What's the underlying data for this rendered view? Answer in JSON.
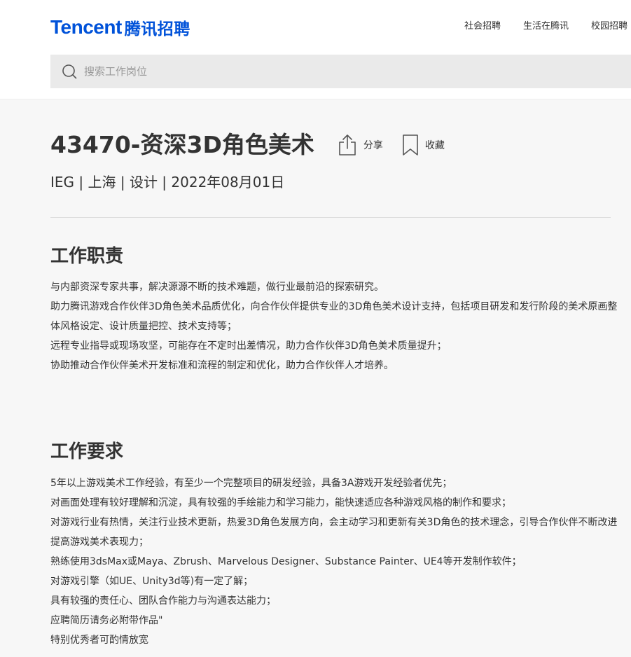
{
  "header": {
    "logo_en": "Tencent",
    "logo_cn": "腾讯招聘",
    "nav": [
      "社会招聘",
      "生活在腾讯",
      "校园招聘"
    ],
    "search_placeholder": "搜索工作岗位",
    "brand_color": "#0052d9"
  },
  "job": {
    "title": "43470-资深3D角色美术",
    "share_label": "分享",
    "favorite_label": "收藏",
    "meta": "IEG | 上海 | 设计 | 2022年08月01日"
  },
  "duties": {
    "heading": "工作职责",
    "items": [
      "与内部资深专家共事，解决源源不断的技术难题，做行业最前沿的探索研究。",
      "助力腾讯游戏合作伙伴3D角色美术品质优化，向合作伙伴提供专业的3D角色美术设计支持，包括项目研发和发行阶段的美术原画整体风格设定、设计质量把控、技术支持等；",
      "远程专业指导或现场攻坚，可能存在不定时出差情况，助力合作伙伴3D角色美术质量提升；",
      "协助推动合作伙伴美术开发标准和流程的制定和优化，助力合作伙伴人才培养。"
    ]
  },
  "requirements": {
    "heading": "工作要求",
    "items": [
      "5年以上游戏美术工作经验，有至少一个完整项目的研发经验，具备3A游戏开发经验者优先；",
      "对画面处理有较好理解和沉淀，具有较强的手绘能力和学习能力，能快速适应各种游戏风格的制作和要求；",
      "对游戏行业有热情，关注行业技术更新，热爱3D角色发展方向，会主动学习和更新有关3D角色的技术理念，引导合作伙伴不断改进提高游戏美术表现力；",
      "熟练使用3dsMax或Maya、Zbrush、Marvelous Designer、Substance Painter、UE4等开发制作软件；",
      "对游戏引擎（如UE、Unity3d等)有一定了解；",
      "具有较强的责任心、团队合作能力与沟通表达能力；",
      "应聘简历请务必附带作品\"",
      "特别优秀者可酌情放宽"
    ]
  }
}
